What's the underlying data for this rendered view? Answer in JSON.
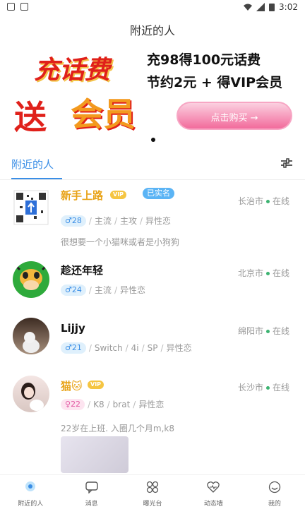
{
  "status_bar": {
    "time": "3:02"
  },
  "header": {
    "title": "附近的人"
  },
  "banner": {
    "headline1": "充话费",
    "headline2": "送",
    "headline3": "会员",
    "line1": "充98得100元话费",
    "line2": "节约2元 + 得VIP会员",
    "button": "点击购买 →",
    "colors": {
      "red": "#e0201a",
      "orange": "#f39a1e",
      "pink": "#f26b9c"
    }
  },
  "tabs": {
    "active": "附近的人"
  },
  "users": [
    {
      "name": "新手上路",
      "vip": "VIP",
      "verified": "已实名",
      "age": "28",
      "tags": [
        "主流",
        "主攻",
        "异性恋"
      ],
      "location": "长治市",
      "status": "在线",
      "bio": "很想要一个小猫咪或者是小狗狗"
    },
    {
      "name": "趁还年轻",
      "age": "24",
      "tags": [
        "主流",
        "异性恋"
      ],
      "location": "北京市",
      "status": "在线"
    },
    {
      "name": "Lijjy",
      "age": "21",
      "tags": [
        "Switch",
        "4i",
        "SP",
        "异性恋"
      ],
      "location": "绵阳市",
      "status": "在线"
    },
    {
      "name": "猫🐱",
      "vip": "VIP",
      "age": "22",
      "tags": [
        "K8",
        "brat",
        "异性恋"
      ],
      "location": "长沙市",
      "status": "在线",
      "bio": "22岁在上班. 入圈几个月m,k8"
    }
  ],
  "nav": [
    {
      "label": "附近的人",
      "icon": "location-icon"
    },
    {
      "label": "消息",
      "icon": "chat-icon"
    },
    {
      "label": "曝光台",
      "icon": "grid-icon"
    },
    {
      "label": "动态墙",
      "icon": "heart-pulse-icon"
    },
    {
      "label": "我的",
      "icon": "smile-icon"
    }
  ]
}
